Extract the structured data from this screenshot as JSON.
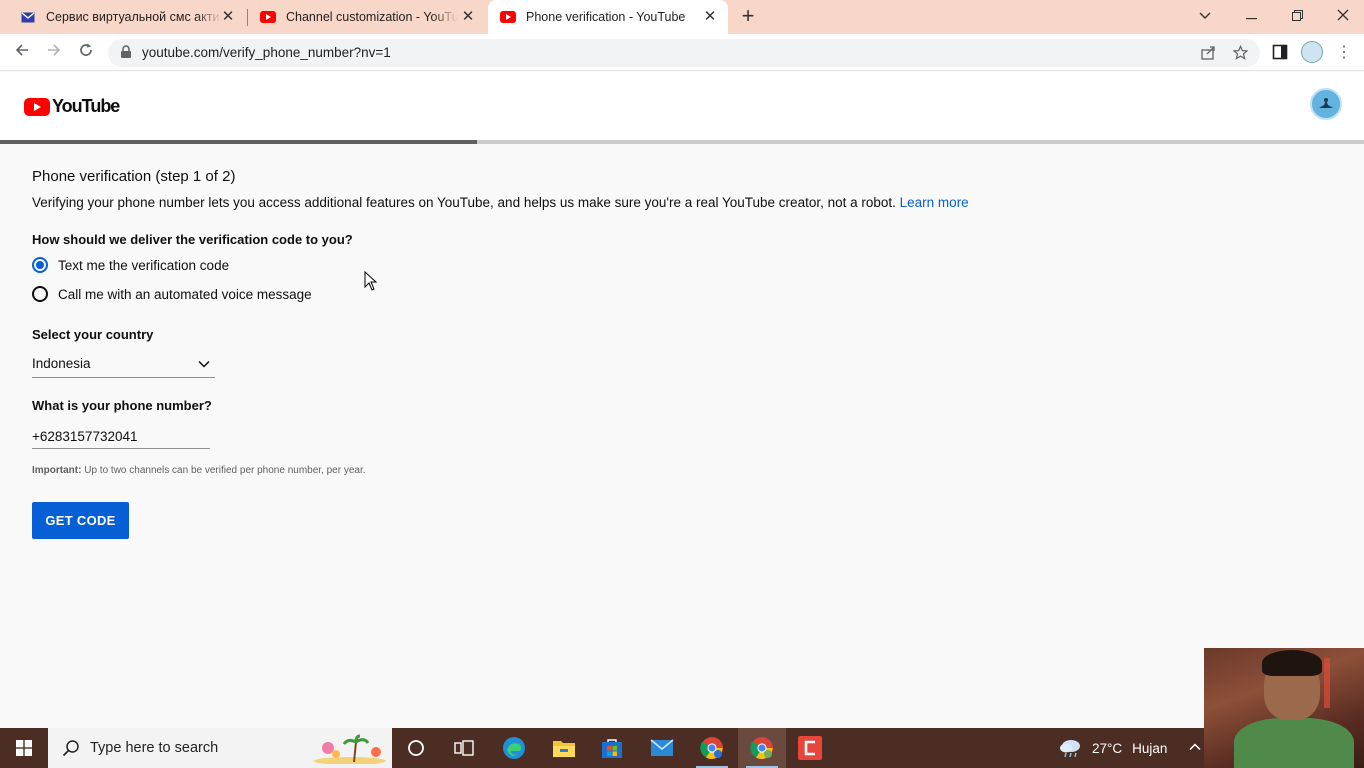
{
  "browser": {
    "tabs": [
      {
        "title": "Сервис виртуальной смс активации",
        "icon": "mail-icon",
        "active": false
      },
      {
        "title": "Channel customization - YouTube Studio",
        "icon": "youtube-icon",
        "active": false
      },
      {
        "title": "Phone verification - YouTube",
        "icon": "youtube-icon",
        "active": true
      }
    ],
    "url": "youtube.com/verify_phone_number?nv=1"
  },
  "header": {
    "logo_text": "YouTube"
  },
  "progress_fraction": 0.35,
  "verification": {
    "title": "Phone verification (step 1 of 2)",
    "description": "Verifying your phone number lets you access additional features on YouTube, and helps us make sure you're a real YouTube creator, not a robot.",
    "learn_more": "Learn more",
    "delivery_question": "How should we deliver the verification code to you?",
    "options": [
      {
        "label": "Text me the verification code",
        "selected": true
      },
      {
        "label": "Call me with an automated voice message",
        "selected": false
      }
    ],
    "country_label": "Select your country",
    "country_value": "Indonesia",
    "phone_label": "What is your phone number?",
    "phone_value": "+6283157732041",
    "note_bold": "Important:",
    "note_text": "Up to two channels can be verified per phone number, per year.",
    "get_code": "GET CODE"
  },
  "taskbar": {
    "search_placeholder": "Type here to search",
    "apps": [
      "cortana-icon",
      "task-view-icon",
      "edge-icon",
      "file-explorer-icon",
      "store-icon",
      "mail-icon",
      "chrome-icon",
      "chrome-icon",
      "capcut-icon"
    ],
    "weather_temp": "27°C",
    "weather_text": "Hujan"
  },
  "colors": {
    "accent": "#065fd4",
    "youtube_red": "#ff0000",
    "tabbar": "#f9d7c8",
    "taskbar": "#4b2d24"
  }
}
